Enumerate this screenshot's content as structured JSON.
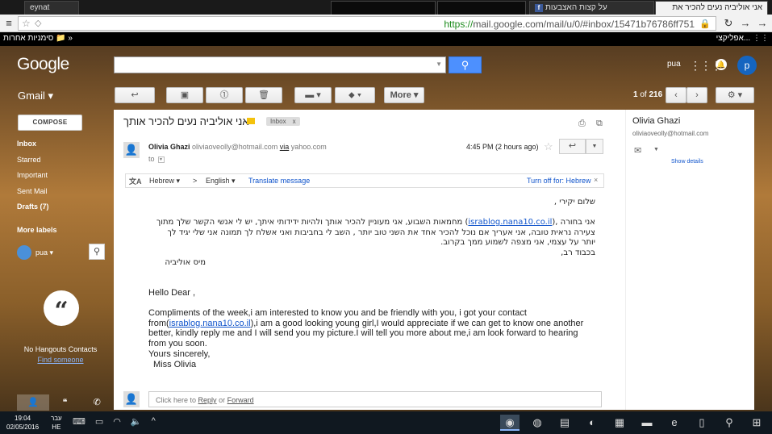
{
  "browser": {
    "tabs": [
      {
        "label": "eynat",
        "active": false
      },
      {
        "label": "",
        "active": false
      },
      {
        "label": "",
        "active": false
      },
      {
        "label": "על קצות האצבעות",
        "active": false
      },
      {
        "label": "אני אוליביה נעים להכיר את",
        "active": true
      }
    ],
    "url_prefix": "https://",
    "url_rest": "mail.google.com/mail/u/0/#inbox/15471b76786ff751",
    "bookmarks_left": "סימניות אחרות",
    "bookmarks_right": "אפליקצי..."
  },
  "header": {
    "logo": "Google",
    "search_icon": "search-icon",
    "username": "pua",
    "avatar_letter": "p"
  },
  "toolbar": {
    "gmail_label": "Gmail ▾",
    "more_label": "More ▾",
    "pager_range": "1",
    "pager_of": "of",
    "pager_total": "216"
  },
  "nav": {
    "compose": "COMPOSE",
    "items": [
      {
        "label": "Inbox",
        "bold": true
      },
      {
        "label": "Starred",
        "bold": false
      },
      {
        "label": "Important",
        "bold": false
      },
      {
        "label": "Sent Mail",
        "bold": false
      },
      {
        "label": "Drafts (7)",
        "bold": true
      },
      {
        "label": "More labels",
        "bold": false
      }
    ],
    "hangouts_user": "pua ▾",
    "no_hangouts": "No Hangouts Contacts",
    "find_someone": "Find someone"
  },
  "message": {
    "subject": "אני אוליביה נעים להכיר אותך",
    "label_chip": "Inbox",
    "label_chip_close": "x",
    "sender_name": "Olivia Ghazi",
    "sender_email": "oliviaoveolly@hotmail.com",
    "via": "via",
    "via_domain": "yahoo.com",
    "to": "to",
    "date": "4:45 PM (2 hours ago)",
    "translate": {
      "from_lang": "Hebrew ▾",
      "arrow": ">",
      "to_lang": "English ▾",
      "translate_link": "Translate message",
      "turn_off": "Turn off for: Hebrew",
      "close": "×"
    },
    "hebrew": {
      "greeting": "שלום יקירי ,",
      "line1_a": "אני בחורה ,(",
      "line1_link": "israblog.nana10.co.il",
      "line1_b": ") מחמאות השבוע, אני מעוניין להכיר אותך ולהיות ידידותי איתך, יש לי אנשי הקשר שלך מתוך",
      "line2": "צעירה נראית טובה, אני אעריך אם נוכל להכיר אחד את השני טוב יותר , השב לי בחביבות ואני אשלח לך תמונה אני שלי יגיד לך",
      "line3": "יותר על עצמי, אני מצפה לשמוע ממך בקרוב.",
      "line4": "בכבוד רב,",
      "line5": "מיס אוליביה"
    },
    "english": {
      "greeting": "Hello Dear ,",
      "p1_a": "Compliments of the week,i am interested to know you and be friendly with you, i got your contact",
      "p1_b_pre": "from(",
      "p1_link": "israblog.nana10.co.il",
      "p1_b_post": "),i am a good looking young girl,I would appreciate if we can get to know one another",
      "p1_c": "better, kindly reply me and I will send you my picture.I will tell you more about me,i am look forward to hearing",
      "p1_d": "from you soon.",
      "sign1": "Yours sincerely,",
      "sign2": "Miss Olivia"
    },
    "reply_prefix": "Click here to",
    "reply_link": "Reply",
    "reply_or": "or",
    "forward_link": "Forward"
  },
  "side": {
    "name": "Olivia Ghazi",
    "email": "oliviaoveolly@hotmail.com",
    "show_details": "Show details"
  },
  "taskbar": {
    "time": "19:04",
    "date": "02/05/2016",
    "lang_top": "עבר",
    "lang_bottom": "HE"
  }
}
